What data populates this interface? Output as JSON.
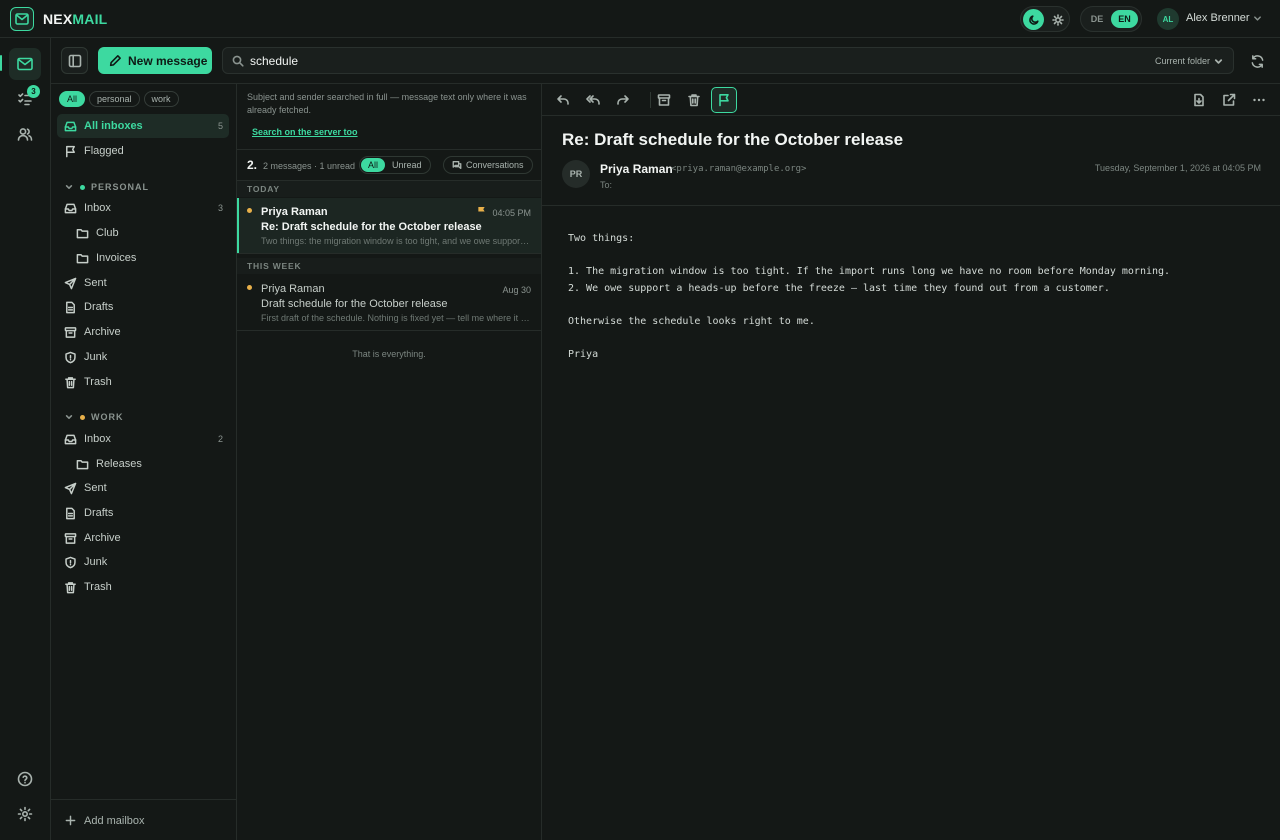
{
  "app": {
    "logo_part1": "NEX",
    "logo_part2": "MAIL",
    "accent_color": "#3dd9a0",
    "flag_color": "#e8b04a"
  },
  "topbar": {
    "theme_icons": [
      "moon-icon",
      "sun-icon"
    ],
    "lang_options": [
      "DE",
      "EN"
    ],
    "lang_selected": "EN",
    "user_initials": "AL",
    "user_name": "Alex Brenner"
  },
  "rail": {
    "items": [
      "mail-icon",
      "tasks-icon",
      "contacts-icon"
    ],
    "tasks_badge": "3",
    "bottom": [
      "help-icon",
      "settings-icon"
    ]
  },
  "toolbar": {
    "new_message_label": "New message",
    "search_value": "schedule",
    "search_scope": "Current folder"
  },
  "sidebar": {
    "filters": [
      "All",
      "personal",
      "work"
    ],
    "all_inboxes_label": "All inboxes",
    "all_inboxes_count": "5",
    "flagged_label": "Flagged",
    "personal": {
      "title": "PERSONAL",
      "dot_color": "#3dd9a0",
      "inbox_label": "Inbox",
      "inbox_count": "3",
      "sub1": "Club",
      "sub2": "Invoices",
      "sent": "Sent",
      "drafts": "Drafts",
      "archive": "Archive",
      "junk": "Junk",
      "trash": "Trash"
    },
    "work": {
      "title": "WORK",
      "dot_color": "#e8b04a",
      "inbox_label": "Inbox",
      "inbox_count": "2",
      "sub1": "Releases",
      "sent": "Sent",
      "drafts": "Drafts",
      "archive": "Archive",
      "junk": "Junk",
      "trash": "Trash"
    },
    "add_mailbox_label": "Add mailbox"
  },
  "list": {
    "search_note": "Subject and sender searched in full — message text only where it was already fetched.",
    "server_link": "Search on the server too",
    "count": "2.",
    "meta": "2 messages · 1 unread",
    "seg_all": "All",
    "seg_unread": "Unread",
    "conversations_label": "Conversations",
    "group_today": "TODAY",
    "group_week": "THIS WEEK",
    "messages": [
      {
        "sender": "Priya Raman",
        "subject": "Re: Draft schedule for the October release",
        "preview": "Two things: the migration window is too tight, and we owe support a heads-up before the freeze",
        "time": "04:05 PM",
        "flagged": true,
        "unread": true
      },
      {
        "sender": "Priya Raman",
        "subject": "Draft schedule for the October release",
        "preview": "First draft of the schedule. Nothing is fixed yet — tell me where it looks wrong",
        "time": "Aug 30",
        "flagged": false,
        "unread": true
      }
    ],
    "end_note": "That is everything."
  },
  "reader": {
    "toolbar": [
      "reply-icon",
      "reply-all-icon",
      "forward-icon",
      "archive-icon",
      "trash-icon",
      "flag-icon",
      "download-icon",
      "external-link-icon",
      "more-icon"
    ],
    "subject": "Re: Draft schedule for the October release",
    "avatar": "PR",
    "from_name": "Priya Raman",
    "from_email": "<priya.raman@example.org>",
    "to_label": "To:",
    "date": "Tuesday, September 1, 2026 at 04:05 PM",
    "body": {
      "l1": "Two things:",
      "l2": "",
      "l3": "1. The migration window is too tight. If the import runs long we have no room before Monday morning.",
      "l4": "2. We owe support a heads-up before the freeze — last time they found out from a customer.",
      "l5": "",
      "l6": "Otherwise the schedule looks right to me.",
      "l7": "",
      "l8": "Priya"
    }
  }
}
